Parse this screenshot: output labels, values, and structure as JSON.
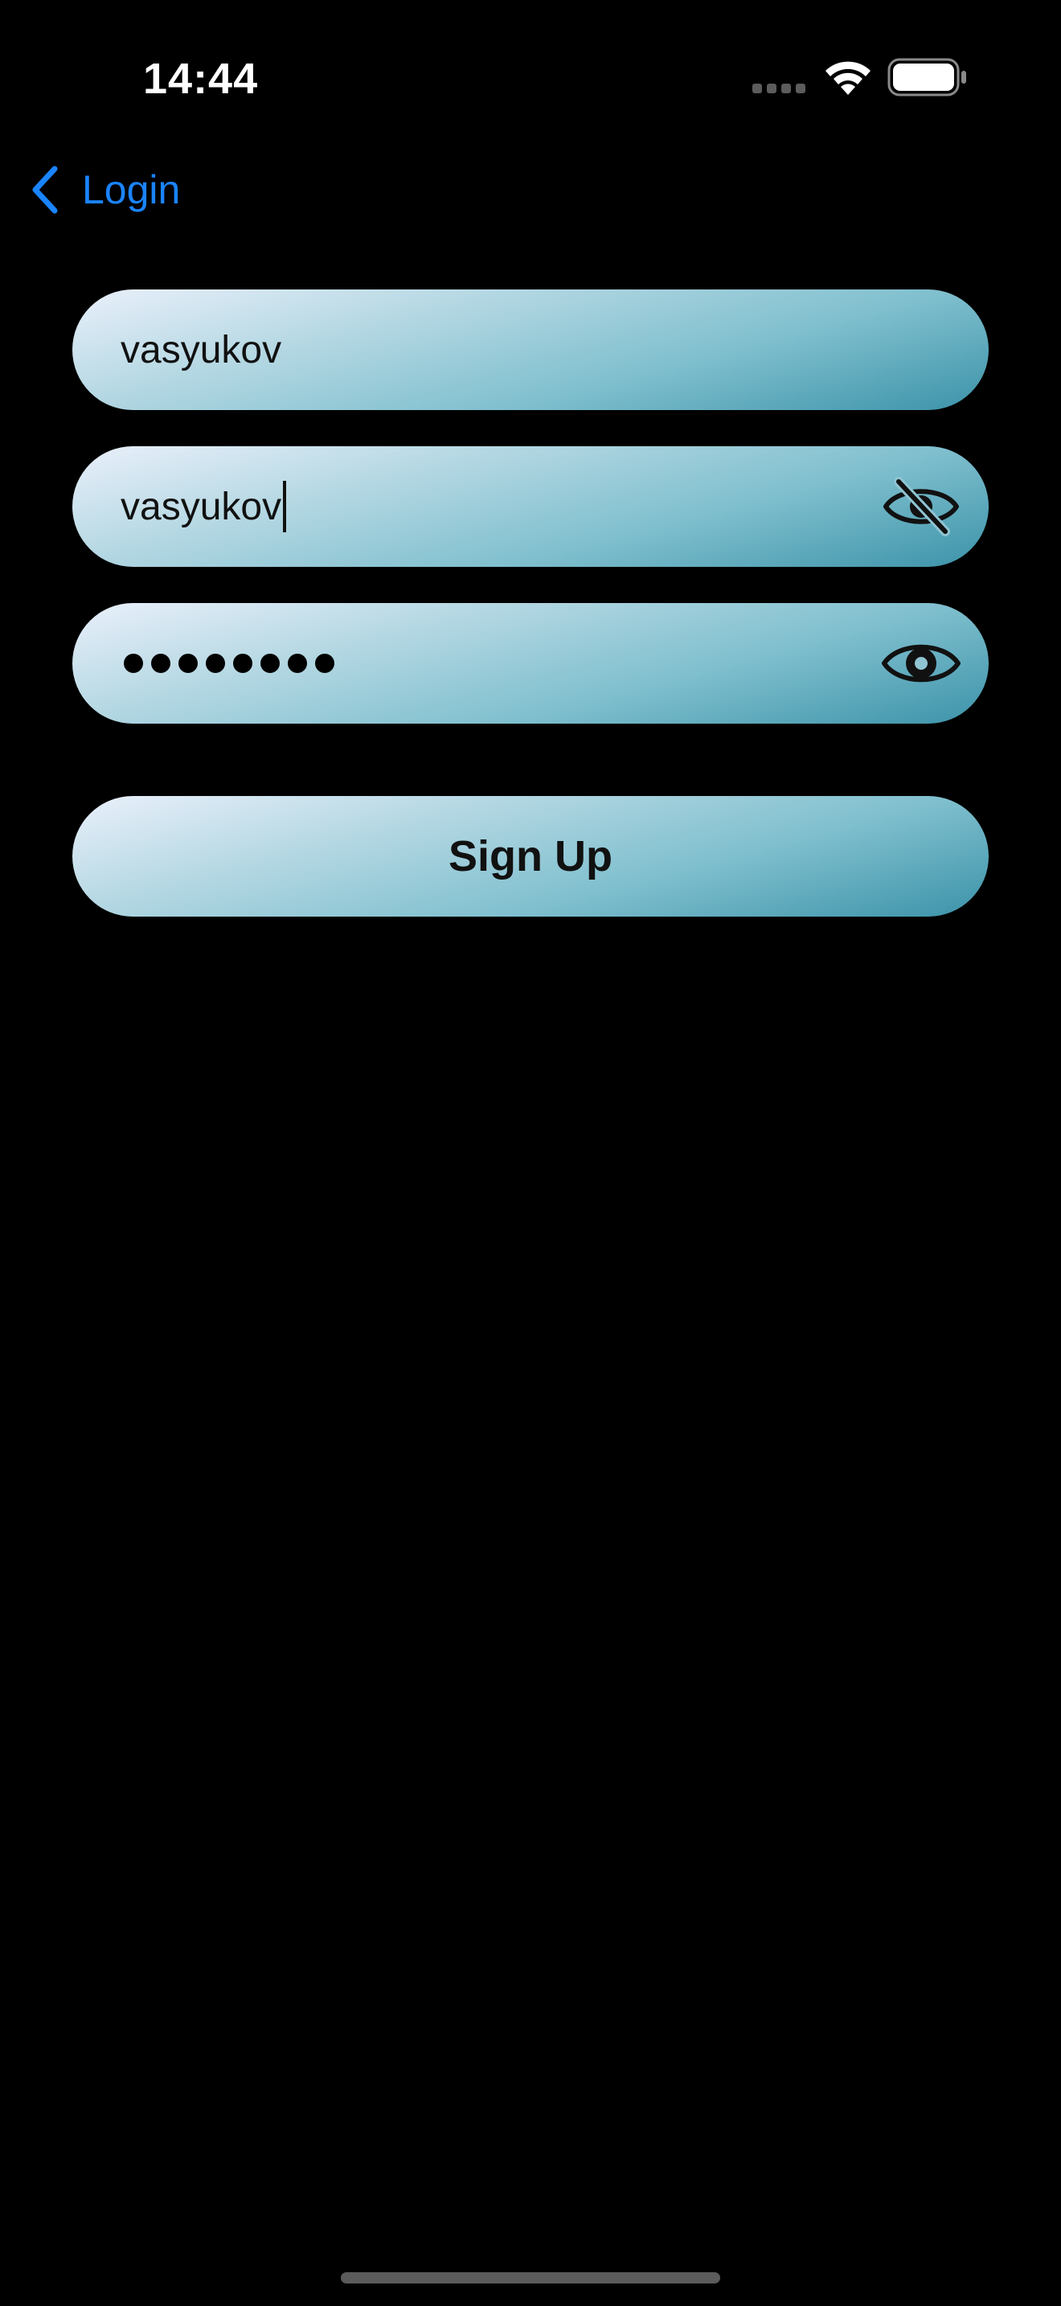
{
  "status_bar": {
    "time": "14:44",
    "icons": [
      "signal-dots-icon",
      "wifi-icon",
      "battery-icon"
    ]
  },
  "nav": {
    "back_label": "Login",
    "back_icon": "chevron-left-icon",
    "accent_color": "#1a84ff"
  },
  "form": {
    "username_value": "vasyukov",
    "password_value": "vasyukov",
    "password_visibility_icon": "eye-slash-icon",
    "confirm_password_masked_count": 8,
    "confirm_visibility_icon": "eye-icon",
    "sign_up_label": "Sign Up"
  },
  "colors": {
    "background": "#000000",
    "pill_gradient_start": "#eaf0fb",
    "pill_gradient_end": "#3c93a9"
  }
}
